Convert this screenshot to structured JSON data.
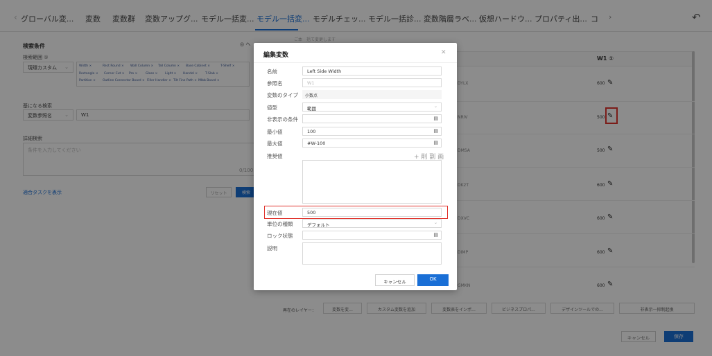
{
  "tabs": {
    "items": [
      "グローバル変...",
      "変数",
      "変数群",
      "変数アップグ...",
      "モデル一括変...",
      "モデル一括変...",
      "モデルチェッ...",
      "モデル一括診...",
      "変数階層ラベ...",
      "仮想ハードウ...",
      "プロパティ出...",
      "コ"
    ],
    "active_index": 5
  },
  "left_panel": {
    "search_conditions_title": "検索条件",
    "search_scope_label": "検索範囲 ①",
    "scope_select": "現環カスタム",
    "chips": [
      "Width ×",
      "Rect Round ×",
      "Wall Column ×",
      "Tall Column ×",
      "Base Cabinet ×",
      "T-Shelf ×",
      "Rectangle ×",
      "Corner Cut ×",
      "Pro ×",
      "Glass ×",
      "Light ×",
      "Handel ×",
      "T-Slab ×",
      "Partition ×",
      "Outline Connector Board ×",
      "Filler Handler ×",
      "Tilt Fine Path ×",
      "Mlbb Board ×"
    ],
    "base_search_title": "基になる検索",
    "base_select": "変数参照名",
    "base_value": "W1",
    "detail_title": "詳細検索",
    "detail_placeholder": "条件を入力してください",
    "counter": "0/100",
    "show_tasks_link": "適合タスクを表示",
    "reset_button": "リセット",
    "search_button": "検索"
  },
  "right_panel": {
    "header_partial": "ご本　括て変更します",
    "column_w1": "W1 ①",
    "rows": [
      {
        "code": "DYLX",
        "value": "600"
      },
      {
        "code": "NRIV",
        "value": "500"
      },
      {
        "code": "DMSA",
        "value": "500"
      },
      {
        "code": "DK2T",
        "value": "600"
      },
      {
        "code": "DXVC",
        "value": "600"
      },
      {
        "code": "DIMP",
        "value": "600"
      },
      {
        "code": "GMKN",
        "value": "600"
      }
    ],
    "layer_label": "再在のレイヤー：",
    "layer_buttons": [
      "変数を変...",
      "カスタム変数を追加",
      "変数表をインポ...",
      "ビジネスプロパ...",
      "デザインツールでの...",
      "非表示一抑制起換"
    ],
    "bottom_cancel": "キャンセル",
    "bottom_save": "保存"
  },
  "modal": {
    "title": "編集変数",
    "fields": {
      "name_label": "名前",
      "name_value": "Left Side Width",
      "ref_label": "参照名",
      "ref_value": "W1",
      "vartype_label": "変数のタイプ",
      "vartype_value": "小数点",
      "value_type_label": "値型",
      "value_type_value": "範囲",
      "hidden_cond_label": "非表示の条件",
      "min_label": "最小値",
      "min_value": "100",
      "max_label": "最大値",
      "max_value": "#W-100",
      "recommend_label": "推奨値",
      "recommend_tools": "+ 削 副 画",
      "current_label": "現在値",
      "current_value": "500",
      "unit_label": "単位の種類",
      "unit_value": "デフォルト",
      "lock_label": "ロック状態",
      "desc_label": "説明"
    },
    "cancel_button": "キャンセル",
    "ok_button": "OK"
  }
}
